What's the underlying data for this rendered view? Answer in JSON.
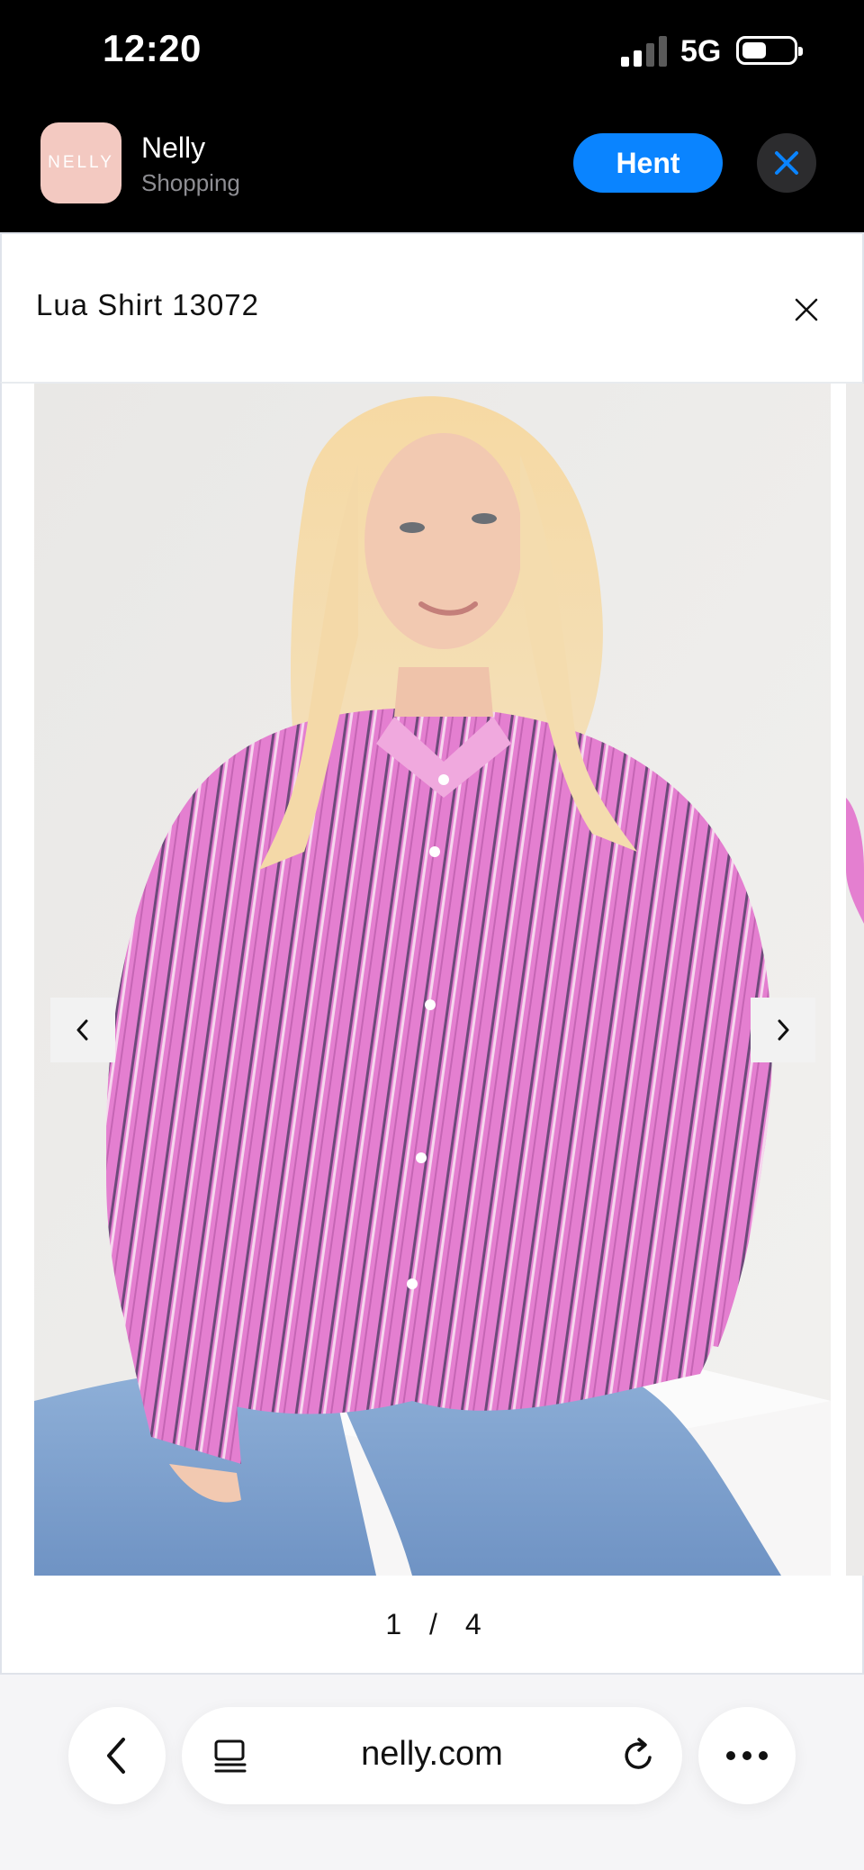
{
  "status_bar": {
    "time": "12:20",
    "network": "5G",
    "battery_level": 0.45
  },
  "app_banner": {
    "icon_text": "NELLY",
    "app_name": "Nelly",
    "app_category": "Shopping",
    "get_label": "Hent",
    "accent_color": "#0a84ff"
  },
  "modal": {
    "title": "Lua Shirt 13072",
    "pager": {
      "current": "1",
      "separator": "/",
      "total": "4"
    }
  },
  "icons": {
    "close": "close-icon",
    "prev": "chevron-left-icon",
    "next": "chevron-right-icon",
    "back": "chevron-left-icon",
    "tabs": "reader-icon",
    "reload": "reload-icon",
    "more": "ellipsis-icon"
  },
  "browser": {
    "url": "nelly.com"
  }
}
